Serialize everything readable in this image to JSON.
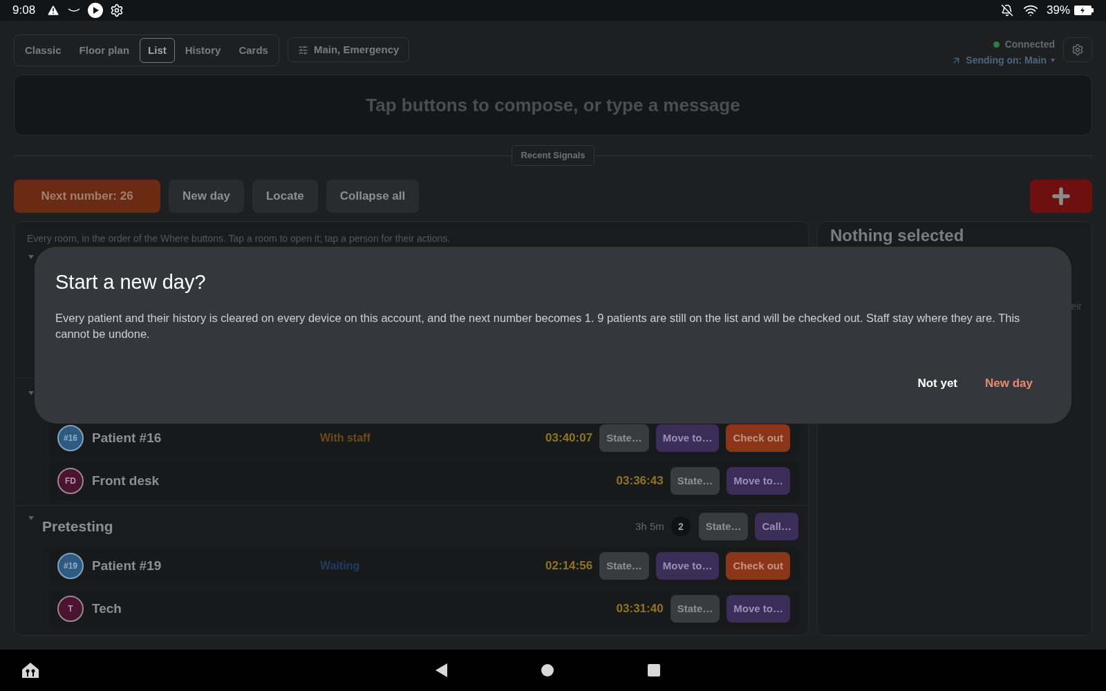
{
  "status_bar": {
    "time": "9:08",
    "battery": "39%"
  },
  "view_tabs": [
    {
      "label": "Classic",
      "selected": false
    },
    {
      "label": "Floor plan",
      "selected": false
    },
    {
      "label": "List",
      "selected": true
    },
    {
      "label": "History",
      "selected": false
    },
    {
      "label": "Cards",
      "selected": false
    }
  ],
  "channel_filter": "Main, Emergency",
  "connection": {
    "status": "Connected",
    "connected": true,
    "sending": "Sending on: Main"
  },
  "composer": {
    "placeholder": "Tap buttons to compose, or type a message"
  },
  "recent_signals": "Recent Signals",
  "actions": [
    {
      "label": "Next number: 26",
      "kind": "primary"
    },
    {
      "label": "New day",
      "kind": "plain"
    },
    {
      "label": "Locate",
      "kind": "plain"
    },
    {
      "label": "Collapse all",
      "kind": "plain"
    }
  ],
  "list": {
    "hint": "Every room, in the order of the Where buttons. Tap a room to open it; tap a person for their actions.",
    "rooms": [
      {
        "expanded": true
      },
      {
        "expanded": true,
        "people": [
          {
            "badge": "#16",
            "kind": "patient",
            "name": "Patient #16",
            "status": "With staff",
            "color": "#6e4b14",
            "timer": "03:40:07",
            "buttons": [
              {
                "label": "State…",
                "kind": "state"
              },
              {
                "label": "Move to…",
                "kind": "move"
              },
              {
                "label": "Check out",
                "kind": "checkout"
              }
            ]
          },
          {
            "badge": "FD",
            "kind": "staff",
            "name": "Front desk",
            "timer": "03:36:43",
            "buttons": [
              {
                "label": "State…",
                "kind": "state"
              },
              {
                "label": "Move to…",
                "kind": "move"
              }
            ]
          }
        ]
      },
      {
        "expanded": true,
        "name": "Pretesting",
        "duration": "3h 5m",
        "count": "2",
        "buttons": [
          {
            "label": "State…",
            "kind": "state"
          },
          {
            "label": "Call…",
            "kind": "move"
          }
        ],
        "people": [
          {
            "badge": "#19",
            "kind": "patient",
            "name": "Patient #19",
            "status": "Waiting",
            "color": "#1f3d63",
            "timer": "02:14:56",
            "buttons": [
              {
                "label": "State…",
                "kind": "state"
              },
              {
                "label": "Move to…",
                "kind": "move"
              },
              {
                "label": "Check out",
                "kind": "checkout"
              }
            ]
          },
          {
            "badge": "T",
            "kind": "staff",
            "name": "Tech",
            "timer": "03:31:40",
            "buttons": [
              {
                "label": "State…",
                "kind": "state"
              },
              {
                "label": "Move to…",
                "kind": "move"
              }
            ]
          }
        ]
      }
    ]
  },
  "detail_panel": {
    "title": "Nothing selected",
    "fragment": "eir"
  },
  "dialog": {
    "title": "Start a new day?",
    "body": "Every patient and their history is cleared on every device on this account, and the next number becomes 1. 9 patients are still on the list and will be checked out. Staff stay where they are. This cannot be undone.",
    "buttons": [
      {
        "label": "Not yet",
        "kind": "cancel"
      },
      {
        "label": "New day",
        "kind": "confirm"
      }
    ]
  }
}
